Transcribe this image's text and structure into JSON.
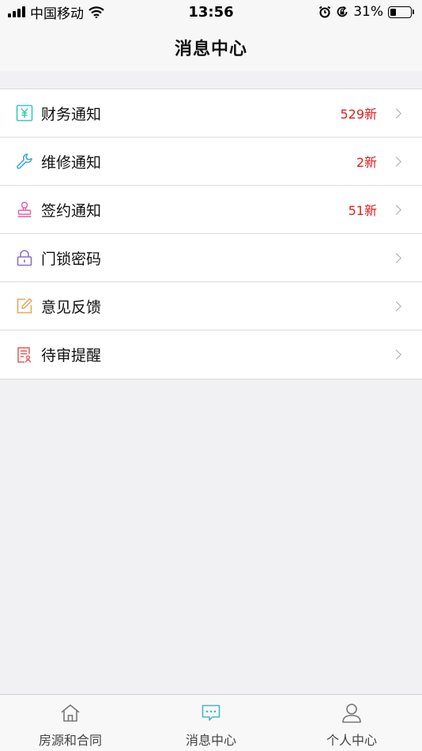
{
  "status_bar": {
    "carrier": "中国移动",
    "time": "13:56",
    "battery_percent": "31%",
    "battery_level": 0.31,
    "icons": [
      "signal-icon",
      "wifi-icon",
      "alarm-icon",
      "rotation-lock-icon",
      "battery-icon"
    ]
  },
  "nav": {
    "title": "消息中心"
  },
  "list": {
    "items": [
      {
        "label": "财务通知",
        "badge": "529新",
        "icon": "finance-icon",
        "icon_color": "#3cc6c0"
      },
      {
        "label": "维修通知",
        "badge": "2新",
        "icon": "wrench-icon",
        "icon_color": "#3aa3e3"
      },
      {
        "label": "签约通知",
        "badge": "51新",
        "icon": "stamp-icon",
        "icon_color": "#e45fa8"
      },
      {
        "label": "门锁密码",
        "badge": "",
        "icon": "lock-icon",
        "icon_color": "#8a6fd0"
      },
      {
        "label": "意见反馈",
        "badge": "",
        "icon": "edit-icon",
        "icon_color": "#f0a35a"
      },
      {
        "label": "待审提醒",
        "badge": "",
        "icon": "review-doc-icon",
        "icon_color": "#e55a5a"
      }
    ]
  },
  "tab_bar": {
    "tabs": [
      {
        "label": "房源和合同",
        "icon": "home-icon",
        "active": false
      },
      {
        "label": "消息中心",
        "icon": "message-icon",
        "active": true,
        "active_color": "#49b6c9"
      },
      {
        "label": "个人中心",
        "icon": "user-icon",
        "active": false
      }
    ]
  }
}
